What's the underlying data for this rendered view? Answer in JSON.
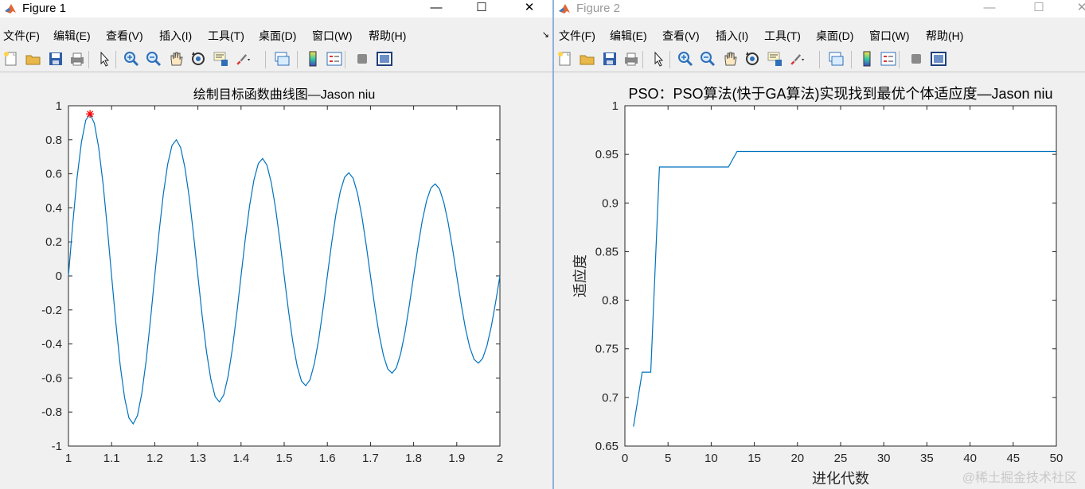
{
  "figure1": {
    "title": "Figure 1",
    "controls": {
      "minimize": "—",
      "maximize": "☐",
      "close": "✕"
    },
    "menu": [
      "文件(F)",
      "编辑(E)",
      "查看(V)",
      "插入(I)",
      "工具(T)",
      "桌面(D)",
      "窗口(W)",
      "帮助(H)"
    ],
    "menu_overflow": "↘",
    "toolbar_icons": [
      "new-figure-icon",
      "open-file-icon",
      "save-icon",
      "print-icon",
      "pointer-icon",
      "zoom-in-icon",
      "zoom-out-icon",
      "pan-hand-icon",
      "rotate-3d-icon",
      "data-cursor-icon",
      "brush-icon",
      "link-plot-icon",
      "colorbar-icon",
      "legend-icon",
      "hide-plot-tools-icon",
      "show-plot-tools-icon"
    ]
  },
  "figure2": {
    "title": "Figure 2",
    "controls": {
      "minimize": "—",
      "maximize": "☐",
      "close": "✕"
    },
    "menu": [
      "文件(F)",
      "编辑(E)",
      "查看(V)",
      "插入(I)",
      "工具(T)",
      "桌面(D)",
      "窗口(W)",
      "帮助(H)"
    ],
    "toolbar_icons": [
      "new-figure-icon",
      "open-file-icon",
      "save-icon",
      "print-icon",
      "pointer-icon",
      "zoom-in-icon",
      "zoom-out-icon",
      "pan-hand-icon",
      "rotate-3d-icon",
      "data-cursor-icon",
      "brush-icon",
      "link-plot-icon",
      "colorbar-icon",
      "legend-icon",
      "hide-plot-tools-icon",
      "show-plot-tools-icon"
    ]
  },
  "watermark": "@稀土掘金技术社区",
  "colors": {
    "line": "#0072bd",
    "marker": "#ff0000",
    "axis": "#262626"
  },
  "chart_data": [
    {
      "type": "line",
      "title": "绘制目标函数曲线图—Jason niu",
      "xlabel": "",
      "ylabel": "",
      "xlim": [
        1,
        2
      ],
      "ylim": [
        -1,
        1
      ],
      "xticks": [
        1,
        1.1,
        1.2,
        1.3,
        1.4,
        1.5,
        1.6,
        1.7,
        1.8,
        1.9,
        2
      ],
      "xtick_labels": [
        "1",
        "1.1",
        "1.2",
        "1.3",
        "1.4",
        "1.5",
        "1.6",
        "1.7",
        "1.8",
        "1.9",
        "2"
      ],
      "yticks": [
        -1,
        -0.8,
        -0.6,
        -0.4,
        -0.2,
        0,
        0.2,
        0.4,
        0.6,
        0.8,
        1
      ],
      "ytick_labels": [
        "-1",
        "-0.8",
        "-0.6",
        "-0.4",
        "-0.2",
        "0",
        "0.2",
        "0.4",
        "0.6",
        "0.8",
        "1"
      ],
      "function": "sin(10*pi*x)/x",
      "x_step": 0.01,
      "marker_points": [
        {
          "x": 1.05,
          "y": 0.952
        }
      ],
      "grid": false
    },
    {
      "type": "line",
      "title": "PSO：PSO算法(快于GA算法)实现找到最优个体适应度—Jason niu",
      "xlabel": "进化代数",
      "ylabel": "适应度",
      "xlim": [
        0,
        50
      ],
      "ylim": [
        0.65,
        1
      ],
      "xticks": [
        0,
        5,
        10,
        15,
        20,
        25,
        30,
        35,
        40,
        45,
        50
      ],
      "xtick_labels": [
        "0",
        "5",
        "10",
        "15",
        "20",
        "25",
        "30",
        "35",
        "40",
        "45",
        "50"
      ],
      "yticks": [
        0.65,
        0.7,
        0.75,
        0.8,
        0.85,
        0.9,
        0.95,
        1
      ],
      "ytick_labels": [
        "0.65",
        "0.7",
        "0.75",
        "0.8",
        "0.85",
        "0.9",
        "0.95",
        "1"
      ],
      "x": [
        1,
        2,
        3,
        4,
        5,
        6,
        7,
        8,
        9,
        10,
        11,
        12,
        13,
        14,
        15,
        16,
        17,
        18,
        19,
        20,
        21,
        22,
        23,
        24,
        25,
        26,
        27,
        28,
        29,
        30,
        31,
        32,
        33,
        34,
        35,
        36,
        37,
        38,
        39,
        40,
        41,
        42,
        43,
        44,
        45,
        46,
        47,
        48,
        49,
        50
      ],
      "y": [
        0.67,
        0.726,
        0.726,
        0.937,
        0.937,
        0.937,
        0.937,
        0.937,
        0.937,
        0.937,
        0.937,
        0.937,
        0.953,
        0.953,
        0.953,
        0.953,
        0.953,
        0.953,
        0.953,
        0.953,
        0.953,
        0.953,
        0.953,
        0.953,
        0.953,
        0.953,
        0.953,
        0.953,
        0.953,
        0.953,
        0.953,
        0.953,
        0.953,
        0.953,
        0.953,
        0.953,
        0.953,
        0.953,
        0.953,
        0.953,
        0.953,
        0.953,
        0.953,
        0.953,
        0.953,
        0.953,
        0.953,
        0.953,
        0.953,
        0.953
      ],
      "grid": false
    }
  ]
}
